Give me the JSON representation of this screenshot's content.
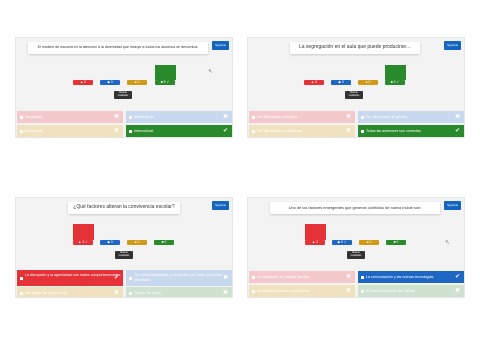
{
  "panels": [
    {
      "question": "El modelo de escuela en la atención a la diversidad que incluye a todos los alumnos se denomina:",
      "next_label": "Siguiente",
      "results_label": "Mostrar resultados",
      "chips": [
        "▲ 0",
        "◆ 0",
        "● 0",
        "■ 9 ✓"
      ],
      "bar_values": [
        0,
        0,
        0,
        9
      ],
      "options": [
        {
          "text": "Integración.",
          "status": "✖"
        },
        {
          "text": "Multicultural.",
          "status": "✖"
        },
        {
          "text": "Excluyente.",
          "status": "✖"
        },
        {
          "text": "Intercultural.",
          "status": "✔"
        }
      ]
    },
    {
      "question": "La segregación en el aula que puede producirse…",
      "next_label": "Siguiente",
      "results_label": "Mostrar resultados",
      "chips": [
        "▲ 0",
        "◆ 0",
        "● 0",
        "■ 3 ✓"
      ],
      "bar_values": [
        0,
        0,
        0,
        3
      ],
      "options": [
        {
          "text": "Por diferencias culturales.",
          "status": "✖"
        },
        {
          "text": "Por diferencias de género.",
          "status": "✖"
        },
        {
          "text": "Por diferencias académicas.",
          "status": "✖"
        },
        {
          "text": "Todas las anteriores son correctas.",
          "status": "✔"
        }
      ]
    },
    {
      "question": "¿Qué factores alteran la convivencia escolar?",
      "next_label": "Siguiente",
      "results_label": "Mostrar resultados",
      "chips": [
        "▲ 3 ✓",
        "◆ 0",
        "● 0",
        "■ 0"
      ],
      "bar_values": [
        3,
        0,
        0,
        0
      ],
      "options": [
        {
          "text": "La disrupción y la agresividad son males comportamentales.",
          "status": "✔"
        },
        {
          "text": "Los comportamientos y conductas son crear conciertos diferentes.",
          "status": "✖"
        },
        {
          "text": "Los estilos de convivencia.",
          "status": "✖"
        },
        {
          "text": "Todo lo de arriba.",
          "status": "✖"
        }
      ]
    },
    {
      "question": "Uno de los factores emergentes que generan conflictos de nueva índole son:",
      "next_label": "Siguiente",
      "results_label": "Mostrar resultados",
      "chips": [
        "▲ 3",
        "◆ 0 ✓",
        "● 0",
        "■ 0"
      ],
      "bar_values": [
        3,
        0,
        0,
        0
      ],
      "options": [
        {
          "text": "La educación en nuevas familias.",
          "status": "✖"
        },
        {
          "text": "La comunicación y las nuevas tecnologías.",
          "status": "✔"
        },
        {
          "text": "Ambientes externos a la escuela.",
          "status": "✖"
        },
        {
          "text": "El desconocimiento del idioma.",
          "status": "✖"
        }
      ]
    }
  ]
}
